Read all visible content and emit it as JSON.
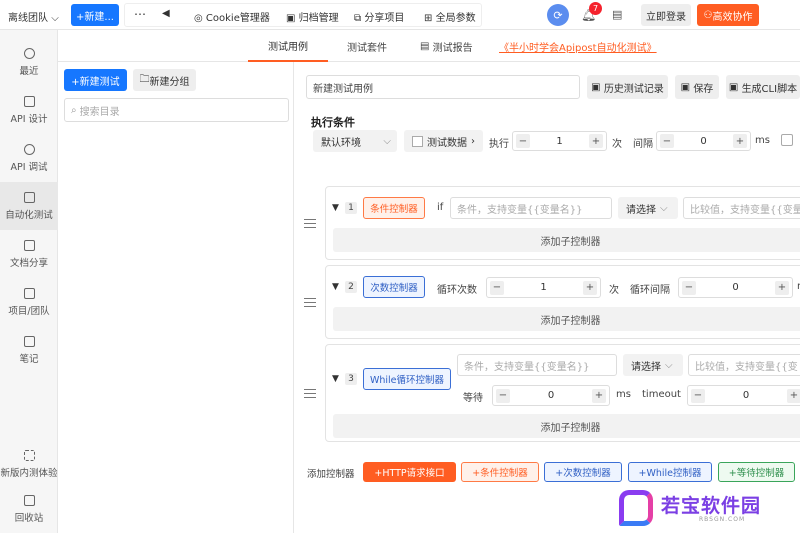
{
  "topbar": {
    "team": "离线团队",
    "new_button": "+新建...",
    "more": "⋯",
    "back": "◀",
    "cookie": "Cookie管理器",
    "archive": "归档管理",
    "share": "分享项目",
    "global_params": "全局参数",
    "notification_count": "7",
    "login": "立即登录",
    "collab": "高效协作"
  },
  "sidebar": {
    "items": [
      {
        "label": "最近"
      },
      {
        "label": "API 设计"
      },
      {
        "label": "API 调试"
      },
      {
        "label": "自动化测试"
      },
      {
        "label": "文档分享"
      },
      {
        "label": "项目/团队"
      },
      {
        "label": "笔记"
      },
      {
        "label": "新版内测体验"
      },
      {
        "label": "回收站"
      }
    ]
  },
  "tree": {
    "new_test": "+新建测试",
    "new_group": "新建分组",
    "search_placeholder": "搜索目录"
  },
  "tabs": [
    {
      "label": "测试用例"
    },
    {
      "label": "测试套件"
    },
    {
      "label": "测试报告"
    },
    {
      "label": "《半小时学会Apipost自动化测试》"
    }
  ],
  "case": {
    "name": "新建测试用例",
    "history": "历史测试记录",
    "save": "保存",
    "cli": "生成CLI脚本"
  },
  "exec": {
    "title": "执行条件",
    "env": "默认环境",
    "test_data": "测试数据",
    "run_label": "执行",
    "run_times": "1",
    "times_unit": "次",
    "interval_label": "间隔",
    "interval_value": "0",
    "ms": "ms"
  },
  "controllers": [
    {
      "num": "1",
      "tag": "条件控制器",
      "if": "if",
      "cond_placeholder": "条件，支持变量{{变量名}}",
      "select": "请选择",
      "compare_placeholder": "比较值，支持变量{{变量",
      "add_child": "添加子控制器"
    },
    {
      "num": "2",
      "tag": "次数控制器",
      "loop_label": "循环次数",
      "loop_value": "1",
      "times_unit": "次",
      "interval_label": "循环间隔",
      "interval_value": "0",
      "ms_unit": "m",
      "add_child": "添加子控制器"
    },
    {
      "num": "3",
      "tag": "While循环控制器",
      "cond_placeholder": "条件，支持变量{{变量名}}",
      "select": "请选择",
      "compare_placeholder": "比较值，支持变量{{变",
      "wait_label": "等待",
      "wait_value": "0",
      "ms": "ms",
      "timeout_label": "timeout",
      "timeout_value": "0",
      "add_child": "添加子控制器"
    }
  ],
  "bottom": {
    "label": "添加控制器",
    "http": "+HTTP请求接口",
    "cond": "+条件控制器",
    "count": "+次数控制器",
    "while": "+While控制器",
    "wait": "+等待控制器"
  },
  "watermark": {
    "brand": "若宝软件园",
    "url": "RBSGN.COM"
  }
}
